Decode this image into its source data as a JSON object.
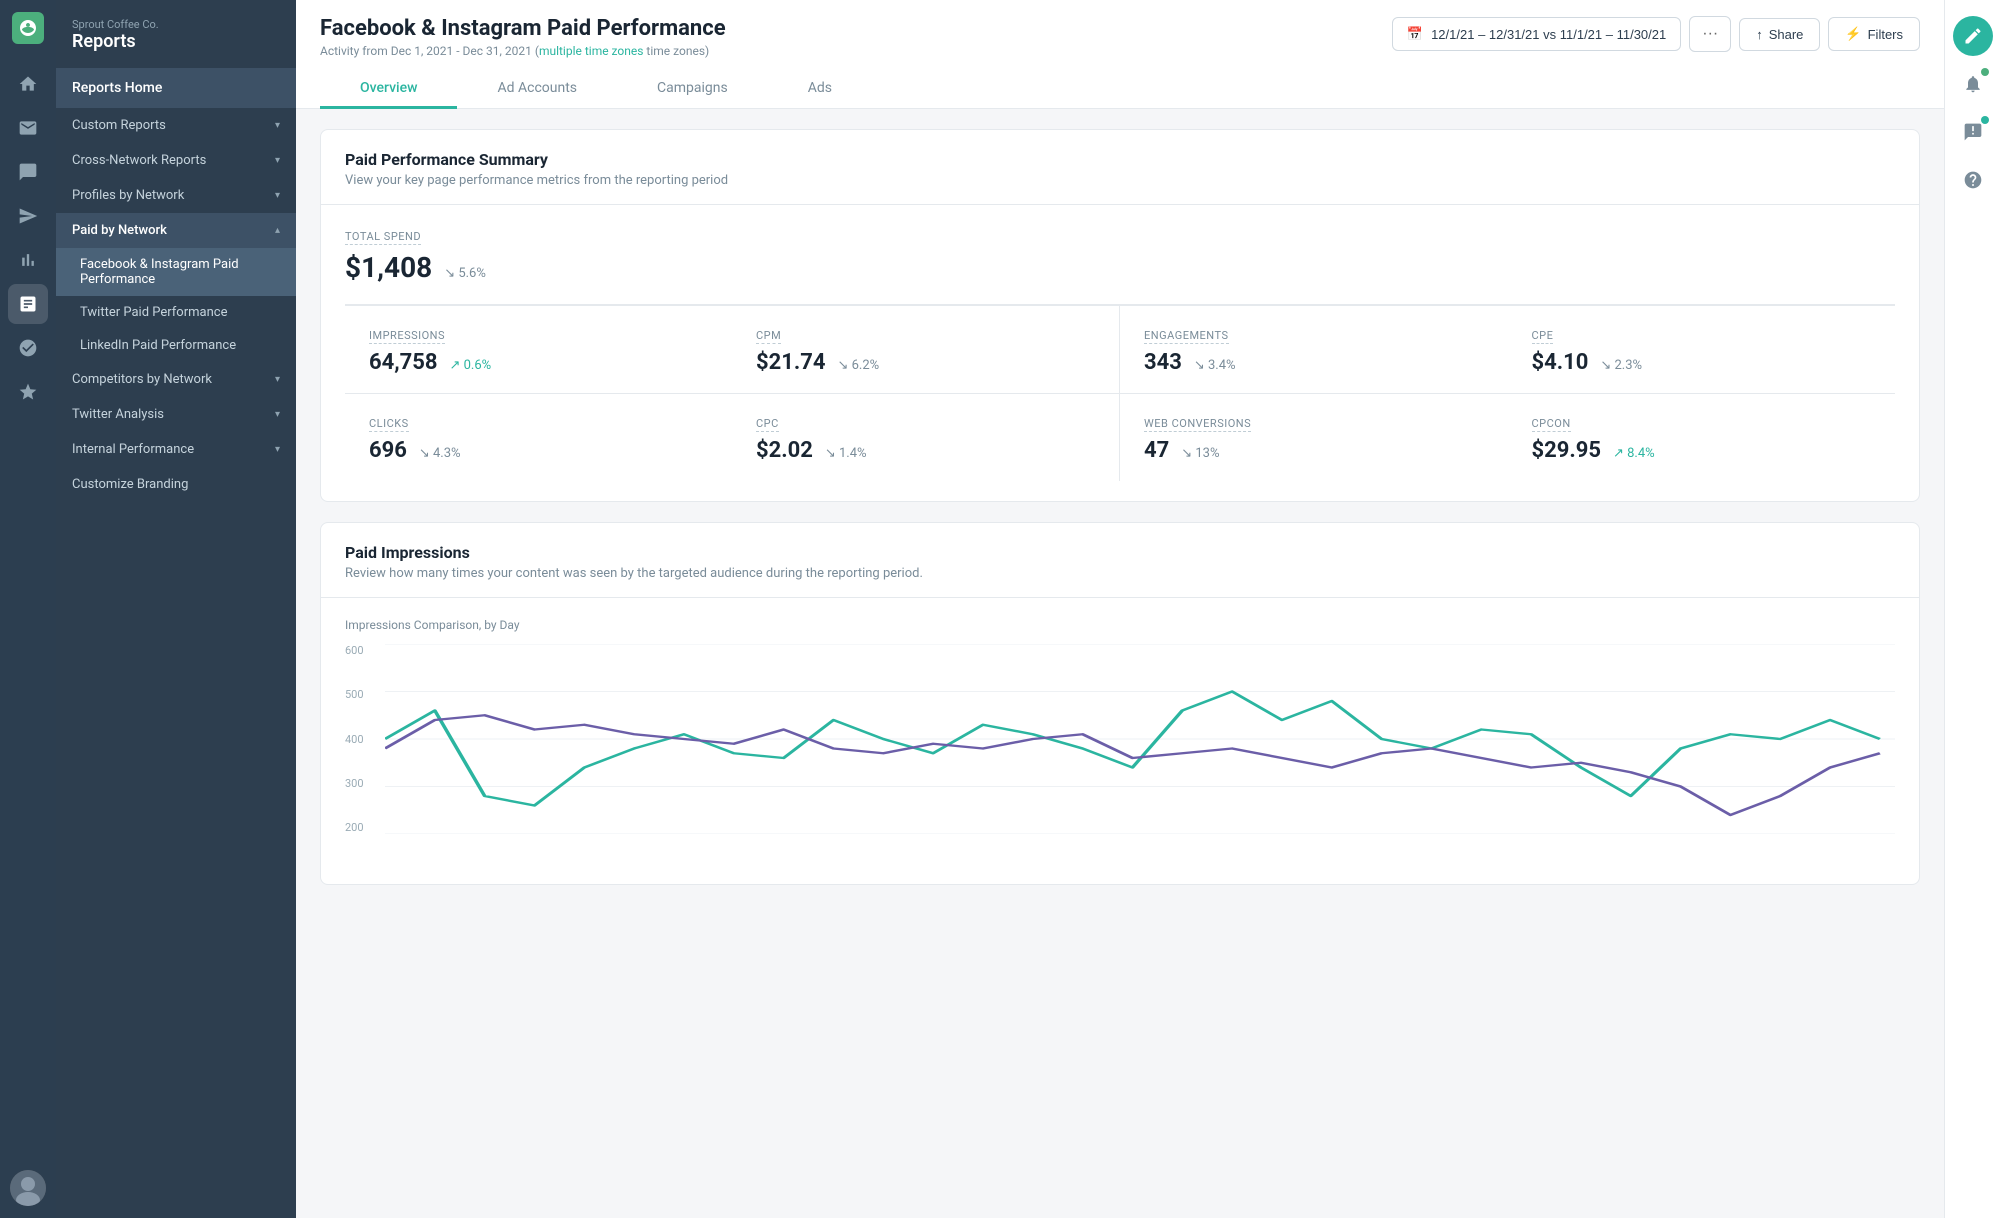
{
  "company": "Sprout Coffee Co.",
  "app_title": "Reports",
  "page_title": "Facebook & Instagram Paid Performance",
  "page_subtitle": "Activity from Dec 1, 2021 - Dec 31, 2021",
  "timezone_label": "multiple time zones",
  "date_range": "12/1/21 – 12/31/21 vs 11/1/21 – 11/30/21",
  "tabs": [
    {
      "label": "Overview",
      "active": true
    },
    {
      "label": "Ad Accounts",
      "active": false
    },
    {
      "label": "Campaigns",
      "active": false
    },
    {
      "label": "Ads",
      "active": false
    }
  ],
  "sidebar": {
    "items": [
      {
        "label": "Reports Home",
        "type": "home",
        "active": true
      },
      {
        "label": "Custom Reports",
        "type": "expandable",
        "expanded": false
      },
      {
        "label": "Cross-Network Reports",
        "type": "expandable",
        "expanded": false
      },
      {
        "label": "Profiles by Network",
        "type": "expandable",
        "expanded": false
      },
      {
        "label": "Paid by Network",
        "type": "expandable",
        "expanded": true
      },
      {
        "label": "Facebook & Instagram Paid Performance",
        "type": "sub",
        "active": true
      },
      {
        "label": "Twitter Paid Performance",
        "type": "sub",
        "active": false
      },
      {
        "label": "LinkedIn Paid Performance",
        "type": "sub",
        "active": false
      },
      {
        "label": "Competitors by Network",
        "type": "expandable",
        "expanded": false
      },
      {
        "label": "Twitter Analysis",
        "type": "expandable",
        "expanded": false
      },
      {
        "label": "Internal Performance",
        "type": "expandable",
        "expanded": false
      },
      {
        "label": "Customize Branding",
        "type": "plain"
      }
    ]
  },
  "summary_card": {
    "title": "Paid Performance Summary",
    "subtitle": "View your key page performance metrics from the reporting period",
    "total_spend_label": "Total Spend",
    "total_spend_value": "$1,408",
    "total_spend_change": "5.6%",
    "total_spend_direction": "down",
    "metrics": [
      {
        "label": "Impressions",
        "value": "64,758",
        "change": "0.6%",
        "direction": "up"
      },
      {
        "label": "CPM",
        "value": "$21.74",
        "change": "6.2%",
        "direction": "down"
      },
      {
        "label": "Engagements",
        "value": "343",
        "change": "3.4%",
        "direction": "down"
      },
      {
        "label": "CPE",
        "value": "$4.10",
        "change": "2.3%",
        "direction": "down"
      },
      {
        "label": "Clicks",
        "value": "696",
        "change": "4.3%",
        "direction": "down"
      },
      {
        "label": "CPC",
        "value": "$2.02",
        "change": "1.4%",
        "direction": "down"
      },
      {
        "label": "Web Conversions",
        "value": "47",
        "change": "13%",
        "direction": "down"
      },
      {
        "label": "CPCon",
        "value": "$29.95",
        "change": "8.4%",
        "direction": "up"
      }
    ]
  },
  "impressions_card": {
    "title": "Paid Impressions",
    "subtitle": "Review how many times your content was seen by the targeted audience during the reporting period.",
    "chart_label": "Impressions Comparison, by Day",
    "y_labels": [
      "600",
      "500",
      "400",
      "300",
      "200"
    ],
    "colors": {
      "line1": "#2bb5a0",
      "line2": "#6b5ea8"
    }
  },
  "buttons": {
    "share": "Share",
    "filters": "Filters",
    "more": "···"
  }
}
